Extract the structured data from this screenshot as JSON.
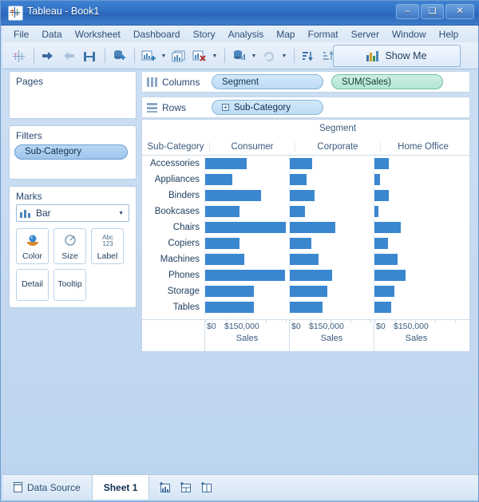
{
  "window": {
    "title": "Tableau - Book1",
    "app_icon": "tableau-icon",
    "controls": {
      "minimize": "–",
      "maximize": "❑",
      "close": "✕"
    }
  },
  "menubar": {
    "items": [
      "File",
      "Data",
      "Worksheet",
      "Dashboard",
      "Story",
      "Analysis",
      "Map",
      "Format",
      "Server",
      "Window",
      "Help"
    ]
  },
  "toolbar": {
    "buttons": [
      {
        "name": "tableau-logo-icon",
        "label": "Start page"
      },
      {
        "name": "undo-icon",
        "label": "Undo"
      },
      {
        "name": "redo-icon",
        "label": "Redo"
      },
      {
        "name": "save-icon",
        "label": "Save"
      },
      {
        "name": "new-data-source-icon",
        "label": "New Data Source"
      },
      {
        "name": "new-worksheet-icon",
        "label": "New Worksheet"
      },
      {
        "name": "duplicate-sheet-icon",
        "label": "Duplicate Sheet"
      },
      {
        "name": "clear-sheet-icon",
        "label": "Clear Sheet"
      },
      {
        "name": "swap-rows-columns-icon",
        "label": "Swap Rows and Columns"
      },
      {
        "name": "refresh-data-source-icon",
        "label": "Refresh Data Source"
      },
      {
        "name": "sort-ascending-icon",
        "label": "Sort Ascending"
      },
      {
        "name": "sort-descending-icon",
        "label": "Sort Descending"
      }
    ],
    "show_me": {
      "label": "Show Me",
      "icon": "show-me-icon"
    }
  },
  "sidebar": {
    "pages": {
      "title": "Pages"
    },
    "filters": {
      "title": "Filters",
      "chips": [
        "Sub-Category"
      ]
    },
    "marks": {
      "title": "Marks",
      "mark_type": "Bar",
      "mark_type_icon": "bar-mark-icon",
      "buttons": [
        {
          "label": "Color",
          "icon": "color-icon"
        },
        {
          "label": "Size",
          "icon": "size-icon"
        },
        {
          "label": "Label",
          "icon": "label-abc-123-icon"
        },
        {
          "label": "Detail",
          "icon": "detail-icon"
        },
        {
          "label": "Tooltip",
          "icon": "tooltip-icon"
        }
      ]
    }
  },
  "shelves": {
    "columns": {
      "label": "Columns",
      "icon": "columns-icon",
      "pills": [
        {
          "text": "Segment",
          "kind": "dimension"
        },
        {
          "text": "SUM(Sales)",
          "kind": "measure"
        }
      ]
    },
    "rows": {
      "label": "Rows",
      "icon": "rows-icon",
      "pills": [
        {
          "text": "Sub-Category",
          "kind": "dimension",
          "expand": "+"
        }
      ]
    }
  },
  "bottom_bar": {
    "data_source": {
      "label": "Data Source",
      "icon": "data-source-icon"
    },
    "sheets": [
      {
        "label": "Sheet 1",
        "active": true
      }
    ],
    "icons": [
      {
        "name": "new-worksheet-tab-icon"
      },
      {
        "name": "new-dashboard-tab-icon"
      },
      {
        "name": "new-story-tab-icon"
      }
    ]
  },
  "chart_data": {
    "type": "bar",
    "title": "",
    "column_field_label": "Segment",
    "row_field_label": "Sub-Category",
    "categories": [
      "Accessories",
      "Appliances",
      "Binders",
      "Bookcases",
      "Chairs",
      "Copiers",
      "Machines",
      "Phones",
      "Storage",
      "Tables"
    ],
    "panels": [
      "Consumer",
      "Corporate",
      "Home Office"
    ],
    "series": [
      {
        "name": "Consumer",
        "values": [
          104000,
          67000,
          140000,
          85000,
          201000,
          85000,
          97000,
          199000,
          122000,
          122000
        ]
      },
      {
        "name": "Corporate",
        "values": [
          55000,
          41000,
          61000,
          38000,
          114000,
          53000,
          71000,
          105000,
          93000,
          81000
        ]
      },
      {
        "name": "Home Office",
        "values": [
          35000,
          14000,
          36000,
          10000,
          65000,
          33000,
          57000,
          78000,
          49000,
          41000
        ]
      }
    ],
    "xlabel": "Sales",
    "ylabel": "Sub-Category",
    "xlim": [
      0,
      205000
    ],
    "axis_ticks": [
      {
        "value": 0,
        "label": "$0"
      },
      {
        "value": 150000,
        "label": "$150,000"
      }
    ],
    "axis_title": "Sales",
    "bar_color": "#3a87d0",
    "grid": false,
    "legend": "none"
  }
}
